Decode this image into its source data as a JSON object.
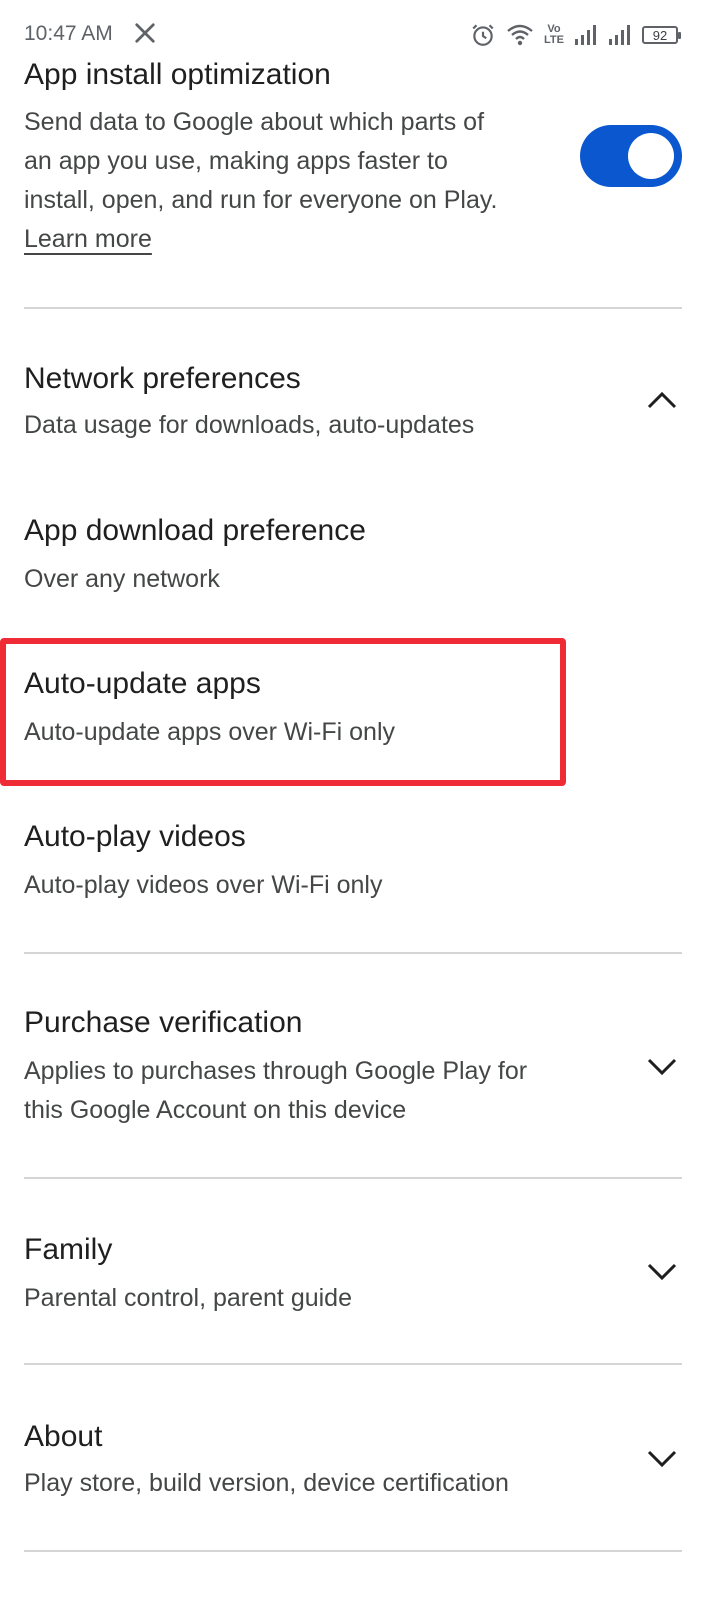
{
  "status_bar": {
    "time": "10:47 AM",
    "app_icon": "x-logo",
    "icons": [
      "alarm-icon",
      "wifi-icon",
      "volte-icon",
      "signal-icon",
      "signal-icon-2"
    ],
    "volte_top": "Vo",
    "volte_bottom": "LTE",
    "battery": "92"
  },
  "app_install": {
    "title": "App install optimization",
    "description_lines": [
      "Send data to Google about which parts of",
      "an app you use, making apps faster to",
      "install, open, and run for everyone on Play."
    ],
    "learn_more": "Learn more",
    "toggle_on": true
  },
  "network": {
    "title": "Network preferences",
    "subtitle": "Data usage for downloads, auto-updates",
    "expanded": true
  },
  "network_items": [
    {
      "title": "App download preference",
      "subtitle": "Over any network"
    },
    {
      "title": "Auto-update apps",
      "subtitle": "Auto-update apps over Wi-Fi only"
    },
    {
      "title": "Auto-play videos",
      "subtitle": "Auto-play videos over Wi-Fi only"
    }
  ],
  "purchase": {
    "title": "Purchase verification",
    "subtitle_lines": [
      "Applies to purchases through Google Play for",
      "this Google Account on this device"
    ]
  },
  "family": {
    "title": "Family",
    "subtitle": "Parental control, parent guide"
  },
  "about": {
    "title": "About",
    "subtitle": "Play store, build version, device certification"
  },
  "colors": {
    "accent": "#0b57d0",
    "highlight": "#ef2b36"
  }
}
